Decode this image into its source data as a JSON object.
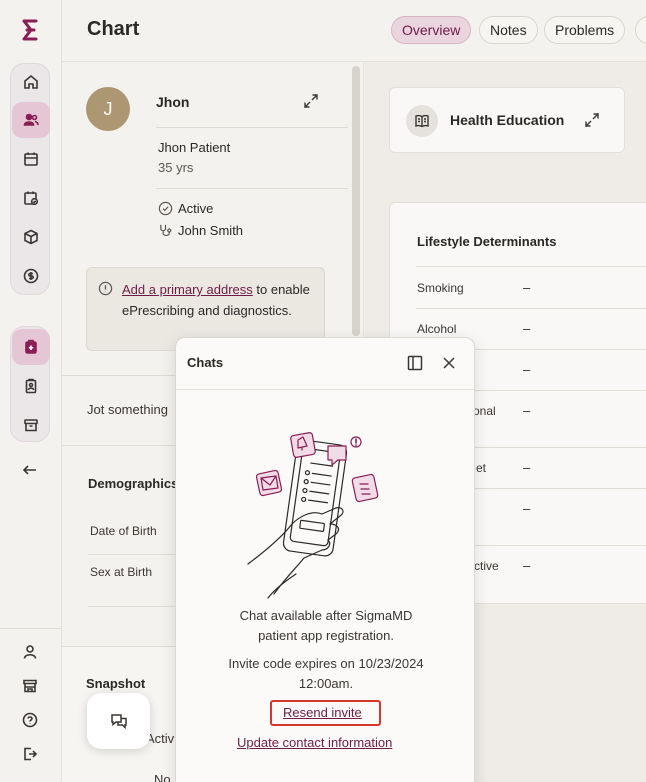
{
  "sidebar": {
    "logo_icon": "sigmamd-logo",
    "nav_main": [
      "home-icon",
      "patients-icon",
      "calendar-icon",
      "tasks-icon",
      "box-icon",
      "billing-icon"
    ],
    "nav_secondary": [
      "medical-kit-icon",
      "clipboard-icon",
      "archive-icon"
    ],
    "back_icon": "arrow-left-icon",
    "bottom": [
      "user-icon",
      "store-icon",
      "help-icon",
      "logout-icon"
    ]
  },
  "header": {
    "title": "Chart",
    "tabs": [
      {
        "label": "Overview",
        "active": true
      },
      {
        "label": "Notes",
        "active": false
      },
      {
        "label": "Problems",
        "active": false
      }
    ]
  },
  "patient": {
    "initial": "J",
    "short_name": "Jhon",
    "full_name": "Jhon Patient",
    "age": "35 yrs",
    "status": "Active",
    "provider": "John Smith",
    "address_link": "Add a primary address",
    "address_rest": " to enable ePrescribing and diagnostics."
  },
  "left": {
    "jot_placeholder": "Jot something",
    "demographics_title": "Demographics",
    "dob_label": "Date of Birth",
    "sex_label": "Sex at Birth",
    "snapshot_title": "Snapshot",
    "snapshot_sub": "Activ",
    "snapshot_sub2": "No"
  },
  "main": {
    "health_education": "Health Education",
    "lifestyle_title": "Lifestyle Determinants",
    "rows": [
      {
        "label": "Smoking",
        "value": "–"
      },
      {
        "label": "Alcohol",
        "value": "–"
      },
      {
        "label": "",
        "value": "–"
      },
      {
        "label": "onal",
        "value": "–"
      },
      {
        "label": "et",
        "value": "–"
      },
      {
        "label": "",
        "value": "–"
      },
      {
        "label": "ctive",
        "value": "–"
      }
    ]
  },
  "chats": {
    "title": "Chats",
    "message": "Chat available after SigmaMD patient app registration.",
    "invite": "Invite code expires on 10/23/2024 12:00am.",
    "resend": "Resend invite",
    "update": "Update contact information"
  },
  "colors": {
    "accent": "#8a1d55",
    "accent_bg": "#e5c6d4",
    "highlight": "#d9362b"
  }
}
